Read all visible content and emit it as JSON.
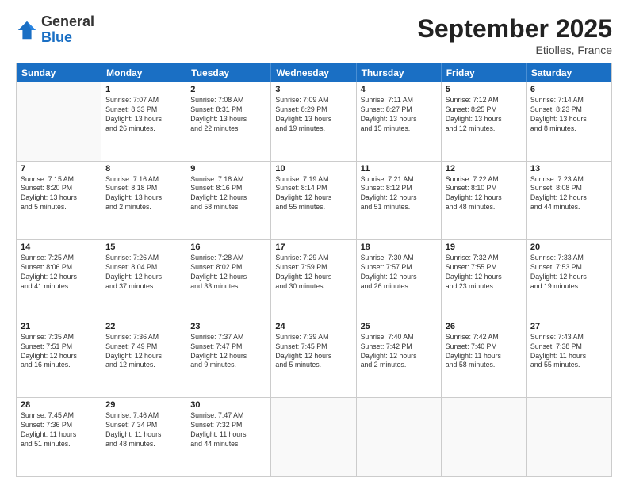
{
  "logo": {
    "general": "General",
    "blue": "Blue"
  },
  "title": {
    "month": "September 2025",
    "location": "Etiolles, France"
  },
  "header_days": [
    "Sunday",
    "Monday",
    "Tuesday",
    "Wednesday",
    "Thursday",
    "Friday",
    "Saturday"
  ],
  "weeks": [
    [
      {
        "day": "",
        "info": ""
      },
      {
        "day": "1",
        "info": "Sunrise: 7:07 AM\nSunset: 8:33 PM\nDaylight: 13 hours\nand 26 minutes."
      },
      {
        "day": "2",
        "info": "Sunrise: 7:08 AM\nSunset: 8:31 PM\nDaylight: 13 hours\nand 22 minutes."
      },
      {
        "day": "3",
        "info": "Sunrise: 7:09 AM\nSunset: 8:29 PM\nDaylight: 13 hours\nand 19 minutes."
      },
      {
        "day": "4",
        "info": "Sunrise: 7:11 AM\nSunset: 8:27 PM\nDaylight: 13 hours\nand 15 minutes."
      },
      {
        "day": "5",
        "info": "Sunrise: 7:12 AM\nSunset: 8:25 PM\nDaylight: 13 hours\nand 12 minutes."
      },
      {
        "day": "6",
        "info": "Sunrise: 7:14 AM\nSunset: 8:23 PM\nDaylight: 13 hours\nand 8 minutes."
      }
    ],
    [
      {
        "day": "7",
        "info": "Sunrise: 7:15 AM\nSunset: 8:20 PM\nDaylight: 13 hours\nand 5 minutes."
      },
      {
        "day": "8",
        "info": "Sunrise: 7:16 AM\nSunset: 8:18 PM\nDaylight: 13 hours\nand 2 minutes."
      },
      {
        "day": "9",
        "info": "Sunrise: 7:18 AM\nSunset: 8:16 PM\nDaylight: 12 hours\nand 58 minutes."
      },
      {
        "day": "10",
        "info": "Sunrise: 7:19 AM\nSunset: 8:14 PM\nDaylight: 12 hours\nand 55 minutes."
      },
      {
        "day": "11",
        "info": "Sunrise: 7:21 AM\nSunset: 8:12 PM\nDaylight: 12 hours\nand 51 minutes."
      },
      {
        "day": "12",
        "info": "Sunrise: 7:22 AM\nSunset: 8:10 PM\nDaylight: 12 hours\nand 48 minutes."
      },
      {
        "day": "13",
        "info": "Sunrise: 7:23 AM\nSunset: 8:08 PM\nDaylight: 12 hours\nand 44 minutes."
      }
    ],
    [
      {
        "day": "14",
        "info": "Sunrise: 7:25 AM\nSunset: 8:06 PM\nDaylight: 12 hours\nand 41 minutes."
      },
      {
        "day": "15",
        "info": "Sunrise: 7:26 AM\nSunset: 8:04 PM\nDaylight: 12 hours\nand 37 minutes."
      },
      {
        "day": "16",
        "info": "Sunrise: 7:28 AM\nSunset: 8:02 PM\nDaylight: 12 hours\nand 33 minutes."
      },
      {
        "day": "17",
        "info": "Sunrise: 7:29 AM\nSunset: 7:59 PM\nDaylight: 12 hours\nand 30 minutes."
      },
      {
        "day": "18",
        "info": "Sunrise: 7:30 AM\nSunset: 7:57 PM\nDaylight: 12 hours\nand 26 minutes."
      },
      {
        "day": "19",
        "info": "Sunrise: 7:32 AM\nSunset: 7:55 PM\nDaylight: 12 hours\nand 23 minutes."
      },
      {
        "day": "20",
        "info": "Sunrise: 7:33 AM\nSunset: 7:53 PM\nDaylight: 12 hours\nand 19 minutes."
      }
    ],
    [
      {
        "day": "21",
        "info": "Sunrise: 7:35 AM\nSunset: 7:51 PM\nDaylight: 12 hours\nand 16 minutes."
      },
      {
        "day": "22",
        "info": "Sunrise: 7:36 AM\nSunset: 7:49 PM\nDaylight: 12 hours\nand 12 minutes."
      },
      {
        "day": "23",
        "info": "Sunrise: 7:37 AM\nSunset: 7:47 PM\nDaylight: 12 hours\nand 9 minutes."
      },
      {
        "day": "24",
        "info": "Sunrise: 7:39 AM\nSunset: 7:45 PM\nDaylight: 12 hours\nand 5 minutes."
      },
      {
        "day": "25",
        "info": "Sunrise: 7:40 AM\nSunset: 7:42 PM\nDaylight: 12 hours\nand 2 minutes."
      },
      {
        "day": "26",
        "info": "Sunrise: 7:42 AM\nSunset: 7:40 PM\nDaylight: 11 hours\nand 58 minutes."
      },
      {
        "day": "27",
        "info": "Sunrise: 7:43 AM\nSunset: 7:38 PM\nDaylight: 11 hours\nand 55 minutes."
      }
    ],
    [
      {
        "day": "28",
        "info": "Sunrise: 7:45 AM\nSunset: 7:36 PM\nDaylight: 11 hours\nand 51 minutes."
      },
      {
        "day": "29",
        "info": "Sunrise: 7:46 AM\nSunset: 7:34 PM\nDaylight: 11 hours\nand 48 minutes."
      },
      {
        "day": "30",
        "info": "Sunrise: 7:47 AM\nSunset: 7:32 PM\nDaylight: 11 hours\nand 44 minutes."
      },
      {
        "day": "",
        "info": ""
      },
      {
        "day": "",
        "info": ""
      },
      {
        "day": "",
        "info": ""
      },
      {
        "day": "",
        "info": ""
      }
    ]
  ]
}
